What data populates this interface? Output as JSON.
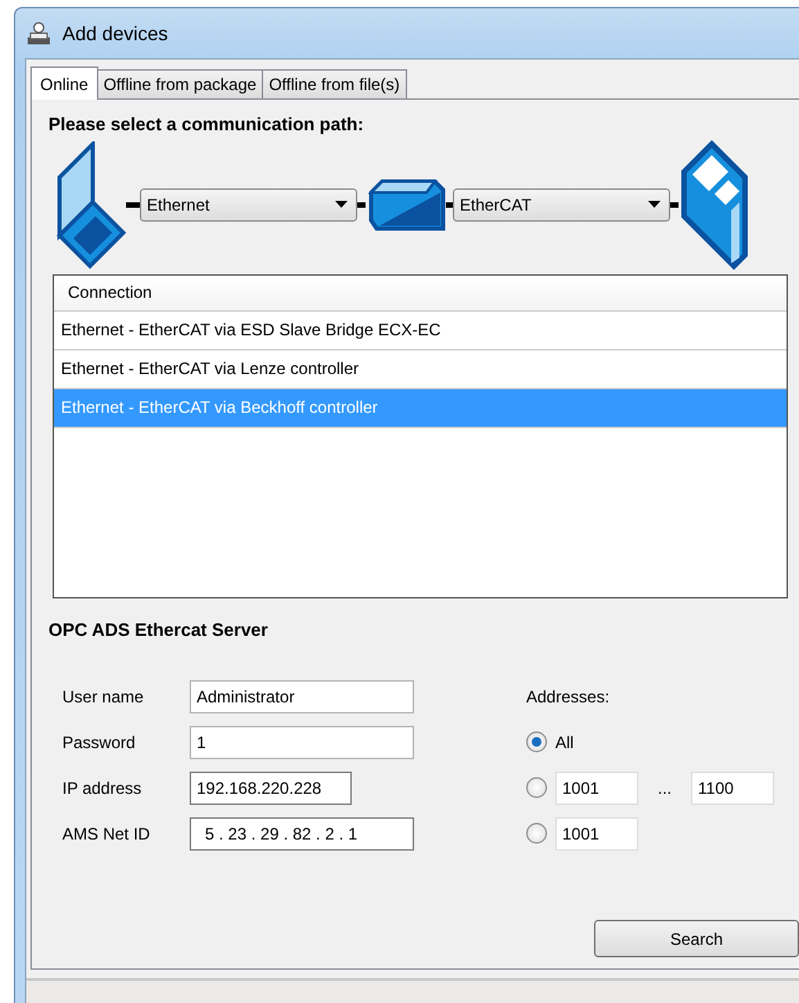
{
  "window": {
    "title": "Add devices"
  },
  "tabs": [
    {
      "label": "Online",
      "selected": true
    },
    {
      "label": "Offline from package",
      "selected": false
    },
    {
      "label": "Offline from file(s)",
      "selected": false
    }
  ],
  "path": {
    "heading": "Please select a communication path:",
    "dropdowns": [
      {
        "value": "Ethernet"
      },
      {
        "value": "EtherCAT"
      }
    ]
  },
  "connections": {
    "column": "Connection",
    "rows": [
      {
        "label": "Ethernet - EtherCAT via ESD Slave Bridge ECX-EC",
        "selected": false
      },
      {
        "label": "Ethernet - EtherCAT via Lenze controller",
        "selected": false
      },
      {
        "label": "Ethernet - EtherCAT via Beckhoff controller",
        "selected": true
      }
    ]
  },
  "server": {
    "heading": "OPC ADS Ethercat Server",
    "fields": [
      {
        "kind": "text",
        "label": "User name",
        "value": "Administrator"
      },
      {
        "kind": "text",
        "label": "Password",
        "value": "1"
      },
      {
        "kind": "ip",
        "label": "IP address",
        "value": "192.168.220.228"
      },
      {
        "kind": "netid",
        "label": "AMS Net ID",
        "value": "5 . 23 . 29 . 82 . 2 . 1"
      }
    ]
  },
  "addresses": {
    "label": "Addresses:",
    "options": [
      {
        "kind": "all",
        "label": "All",
        "selected": true
      },
      {
        "kind": "range",
        "from": "1001",
        "separator": "...",
        "to": "1100",
        "selected": false
      },
      {
        "kind": "single",
        "value": "1001",
        "selected": false
      }
    ]
  },
  "buttons": [
    "Search"
  ]
}
